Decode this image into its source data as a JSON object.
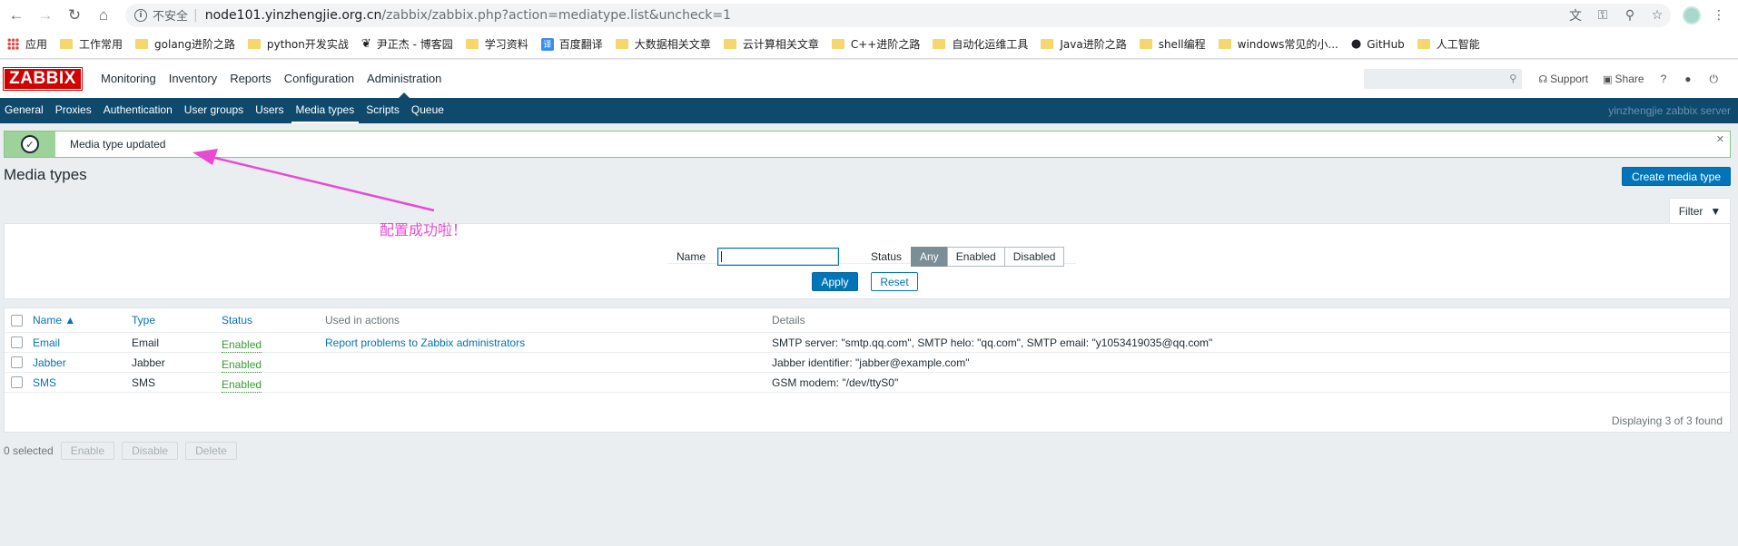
{
  "browser": {
    "insecure_label": "不安全",
    "url_host": "node101.yinzhengjie.org.cn",
    "url_path": "/zabbix/zabbix.php?action=mediatype.list&uncheck=1",
    "bookmarks": [
      {
        "label": "应用",
        "kind": "apps"
      },
      {
        "label": "工作常用",
        "kind": "folder"
      },
      {
        "label": "golang进阶之路",
        "kind": "folder"
      },
      {
        "label": "python开发实战",
        "kind": "folder"
      },
      {
        "label": "尹正杰 - 博客园",
        "kind": "blog"
      },
      {
        "label": "学习资料",
        "kind": "folder"
      },
      {
        "label": "百度翻译",
        "kind": "translate"
      },
      {
        "label": "大数据相关文章",
        "kind": "folder"
      },
      {
        "label": "云计算相关文章",
        "kind": "folder"
      },
      {
        "label": "C++进阶之路",
        "kind": "folder"
      },
      {
        "label": "自动化运维工具",
        "kind": "folder"
      },
      {
        "label": "Java进阶之路",
        "kind": "folder"
      },
      {
        "label": "shell编程",
        "kind": "folder"
      },
      {
        "label": "windows常见的小...",
        "kind": "folder"
      },
      {
        "label": "GitHub",
        "kind": "github"
      },
      {
        "label": "人工智能",
        "kind": "folder"
      }
    ]
  },
  "header": {
    "logo": "ZABBIX",
    "menu": [
      "Monitoring",
      "Inventory",
      "Reports",
      "Configuration",
      "Administration"
    ],
    "support": "Support",
    "share": "Share",
    "help": "?"
  },
  "submenu": {
    "items": [
      "General",
      "Proxies",
      "Authentication",
      "User groups",
      "Users",
      "Media types",
      "Scripts",
      "Queue"
    ],
    "server_name": "yinzhengjie zabbix server"
  },
  "message": {
    "text": "Media type updated"
  },
  "page": {
    "title": "Media types",
    "create_button": "Create media type"
  },
  "filter": {
    "tab_label": "Filter",
    "name_label": "Name",
    "name_value": "",
    "status_label": "Status",
    "status_options": [
      "Any",
      "Enabled",
      "Disabled"
    ],
    "apply": "Apply",
    "reset": "Reset"
  },
  "table": {
    "headers": {
      "name": "Name ▲",
      "type": "Type",
      "status": "Status",
      "actions": "Used in actions",
      "details": "Details"
    },
    "rows": [
      {
        "name": "Email",
        "type": "Email",
        "status": "Enabled",
        "actions": "Report problems to Zabbix administrators",
        "details": "SMTP server: \"smtp.qq.com\", SMTP helo: \"qq.com\", SMTP email: \"y1053419035@qq.com\""
      },
      {
        "name": "Jabber",
        "type": "Jabber",
        "status": "Enabled",
        "actions": "",
        "details": "Jabber identifier: \"jabber@example.com\""
      },
      {
        "name": "SMS",
        "type": "SMS",
        "status": "Enabled",
        "actions": "",
        "details": "GSM modem: \"/dev/ttyS0\""
      }
    ],
    "footer": "Displaying 3 of 3 found"
  },
  "bottom": {
    "selected": "0 selected",
    "enable": "Enable",
    "disable": "Disable",
    "delete": "Delete"
  },
  "annotation": {
    "text": "配置成功啦！",
    "color": "#e84ad4"
  }
}
